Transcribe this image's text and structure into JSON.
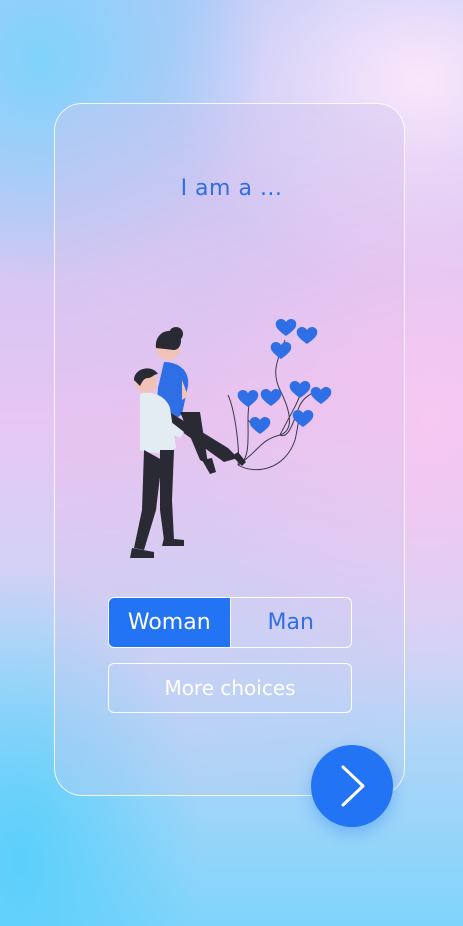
{
  "screen": {
    "title": "I am a ...",
    "accent_color": "#2374f4"
  },
  "gender_toggle": {
    "options": [
      "Woman",
      "Man"
    ],
    "selected": "Woman"
  },
  "more_choices": {
    "label": "More choices"
  },
  "next_button": {
    "icon": "chevron-right-icon"
  },
  "illustration": {
    "icon": "couple-hug-balloons-illustration"
  }
}
